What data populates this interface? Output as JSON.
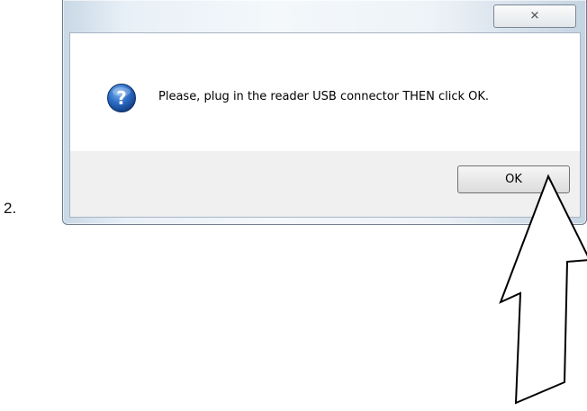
{
  "step": {
    "number": "2."
  },
  "dialog": {
    "close_icon": "close-icon",
    "close_glyph": "✕",
    "message_icon": "question-icon",
    "message": "Please, plug in the reader USB connector THEN click OK.",
    "ok_label": "OK"
  },
  "annotation": {
    "arrow_icon": "up-arrow-icon",
    "points_to": "ok-button"
  },
  "colors": {
    "question_blue": "#1f5fb0",
    "arrow_stroke": "#000000"
  }
}
